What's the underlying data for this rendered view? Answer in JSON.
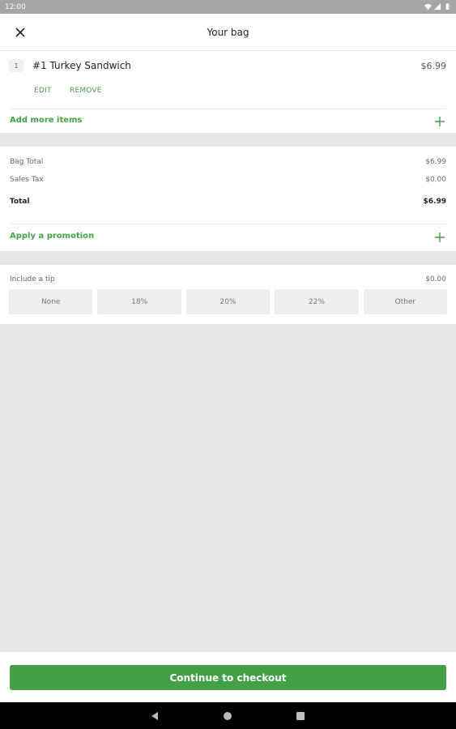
{
  "status_bar": {
    "time": "12:00"
  },
  "header": {
    "title": "Your bag"
  },
  "bag": {
    "items": [
      {
        "quantity": "1",
        "name": "#1 Turkey Sandwich",
        "price": "$6.99",
        "edit_label": "EDIT",
        "remove_label": "REMOVE"
      }
    ],
    "add_more_label": "Add more items"
  },
  "totals": {
    "bag_total_label": "Bag Total",
    "bag_total_value": "$6.99",
    "sales_tax_label": "Sales Tax",
    "sales_tax_value": "$0.00",
    "total_label": "Total",
    "total_value": "$6.99",
    "promotion_label": "Apply a promotion"
  },
  "tip": {
    "label": "Include a tip",
    "value": "$0.00",
    "options": [
      "None",
      "18%",
      "20%",
      "22%",
      "Other"
    ]
  },
  "footer": {
    "checkout_label": "Continue to checkout"
  },
  "colors": {
    "accent": "#43a047",
    "background": "#e6e6e6",
    "status_bar": "#a5a5a5"
  }
}
